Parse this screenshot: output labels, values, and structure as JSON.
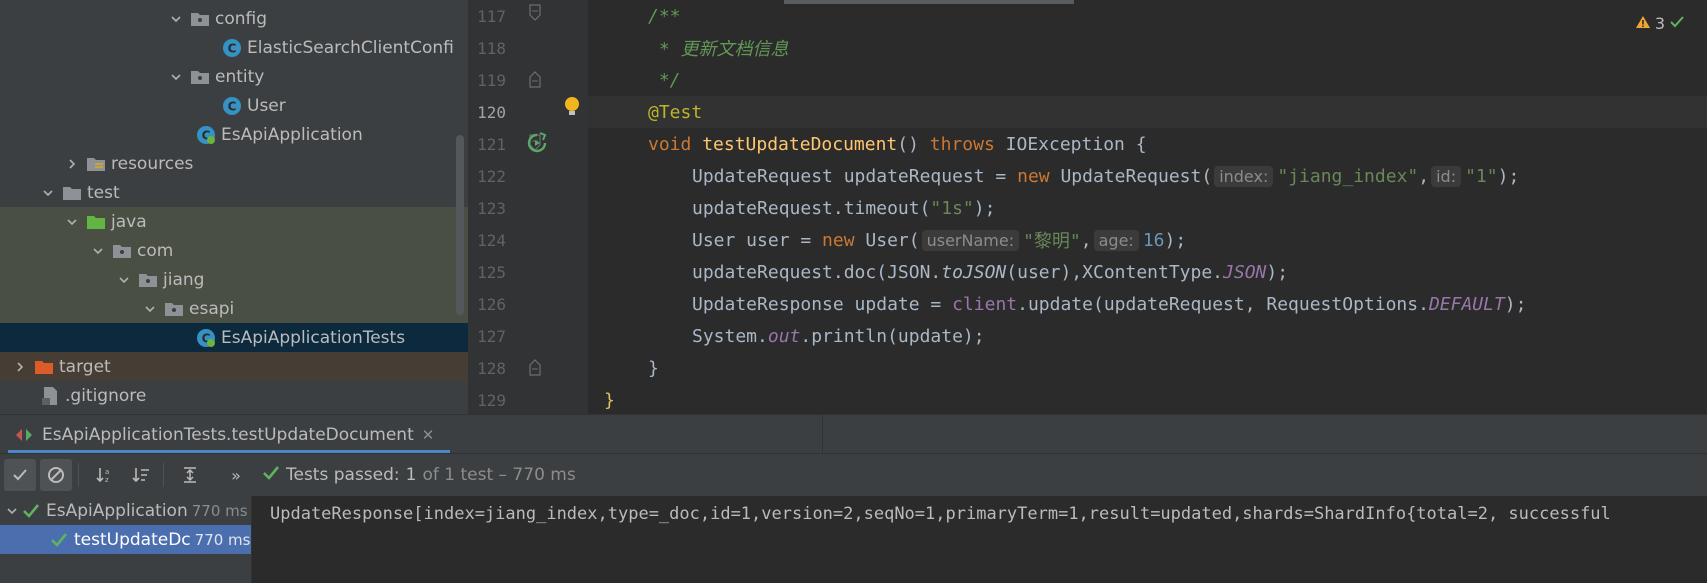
{
  "project_tree": [
    {
      "label": "config",
      "kind": "folder",
      "expanded": true
    },
    {
      "label": "ElasticSearchClientConfi",
      "kind": "class"
    },
    {
      "label": "entity",
      "kind": "folder",
      "expanded": true
    },
    {
      "label": "User",
      "kind": "class"
    },
    {
      "label": "EsApiApplication",
      "kind": "app"
    },
    {
      "label": "resources",
      "kind": "resources",
      "expanded": false
    },
    {
      "label": "test",
      "kind": "folder-plain",
      "expanded": true
    },
    {
      "label": "java",
      "kind": "test-root",
      "expanded": true
    },
    {
      "label": "com",
      "kind": "package",
      "expanded": true
    },
    {
      "label": "jiang",
      "kind": "package",
      "expanded": true
    },
    {
      "label": "esapi",
      "kind": "package",
      "expanded": true
    },
    {
      "label": "EsApiApplicationTests",
      "kind": "test-class"
    },
    {
      "label": "target",
      "kind": "excluded",
      "expanded": false
    },
    {
      "label": ".gitignore",
      "kind": "file"
    }
  ],
  "editor": {
    "line_numbers": [
      "117",
      "118",
      "119",
      "120",
      "121",
      "122",
      "123",
      "124",
      "125",
      "126",
      "127",
      "128",
      "129"
    ],
    "current_line": "120",
    "warnings": {
      "count": "3",
      "icon": "warning-icon"
    },
    "code": {
      "l117": "/**",
      "l118": " * 更新文档信息",
      "l119": " */",
      "l120": "@Test",
      "l121_kw": "void",
      "l121_fn": "testUpdateDocument",
      "l121_p": "() ",
      "l121_throws": "throws",
      "l121_ex": " IOException {",
      "l122_a": "UpdateRequest updateRequest = ",
      "l122_new": "new",
      "l122_b": " UpdateRequest(",
      "l122_hint1": "index:",
      "l122_s1": "\"jiang_index\"",
      "l122_c": ",",
      "l122_hint2": "id:",
      "l122_s2": "\"1\"",
      "l122_d": ");",
      "l123_a": "updateRequest.timeout(",
      "l123_s": "\"1s\"",
      "l123_b": ");",
      "l124_a": "User user = ",
      "l124_new": "new",
      "l124_b": " User(",
      "l124_hint1": "userName:",
      "l124_s": "\"黎明\"",
      "l124_c": ",",
      "l124_hint2": "age:",
      "l124_n": "16",
      "l124_d": ");",
      "l125_a": "updateRequest.doc(JSON.",
      "l125_st1": "toJSON",
      "l125_b": "(user),XContentType.",
      "l125_st2": "JSON",
      "l125_c": ");",
      "l126_a": "UpdateResponse update = ",
      "l126_client": "client",
      "l126_b": ".update(updateRequest, RequestOptions.",
      "l126_st": "DEFAULT",
      "l126_c": ");",
      "l127_a": "System.",
      "l127_st": "out",
      "l127_b": ".println(update);",
      "l128": "}",
      "l129": "}"
    }
  },
  "run_panel": {
    "tab_label": "EsApiApplicationTests.testUpdateDocument",
    "status_prefix": "Tests passed:",
    "status_count": "1",
    "status_rest": "of 1 test – 770 ms",
    "tree": [
      {
        "label": "EsApiApplication",
        "time": "770 ms"
      },
      {
        "label": "testUpdateDc",
        "time": "770 ms"
      }
    ],
    "console_output": "UpdateResponse[index=jiang_index,type=_doc,id=1,version=2,seqNo=1,primaryTerm=1,result=updated,shards=ShardInfo{total=2, successful"
  },
  "colors": {
    "keyword": "#cc7832",
    "string": "#6a8759",
    "function": "#ffc66d",
    "pass_green": "#5fb35f",
    "selection": "#4b6eaf"
  }
}
